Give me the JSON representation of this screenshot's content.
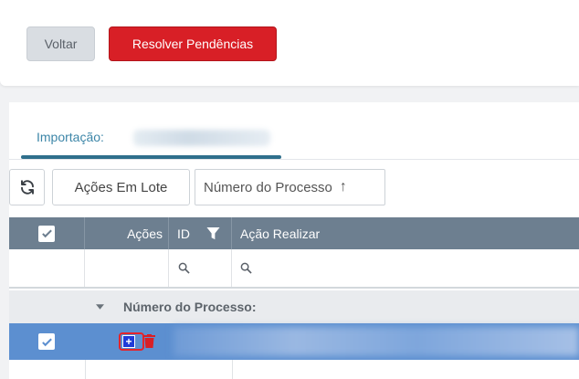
{
  "toolbar": {
    "back_label": "Voltar",
    "resolve_label": "Resolver Pendências"
  },
  "tabs": [
    {
      "label": "Importação:"
    }
  ],
  "grid_toolbar": {
    "batch_label": "Ações Em Lote",
    "sort_label": "Número do Processo",
    "sort_arrow": "↑"
  },
  "grid": {
    "columns": {
      "actions": "Ações",
      "id": "ID",
      "action_to_do": "Ação Realizar"
    },
    "group_label": "Número do Processo:",
    "selected_row": {
      "add_icon": "+"
    }
  },
  "colors": {
    "header_bg": "#6d7f90",
    "selected_row": "#5c8fd0",
    "resolve_button": "#d81f26",
    "tab_accent": "#2f6f8c"
  }
}
